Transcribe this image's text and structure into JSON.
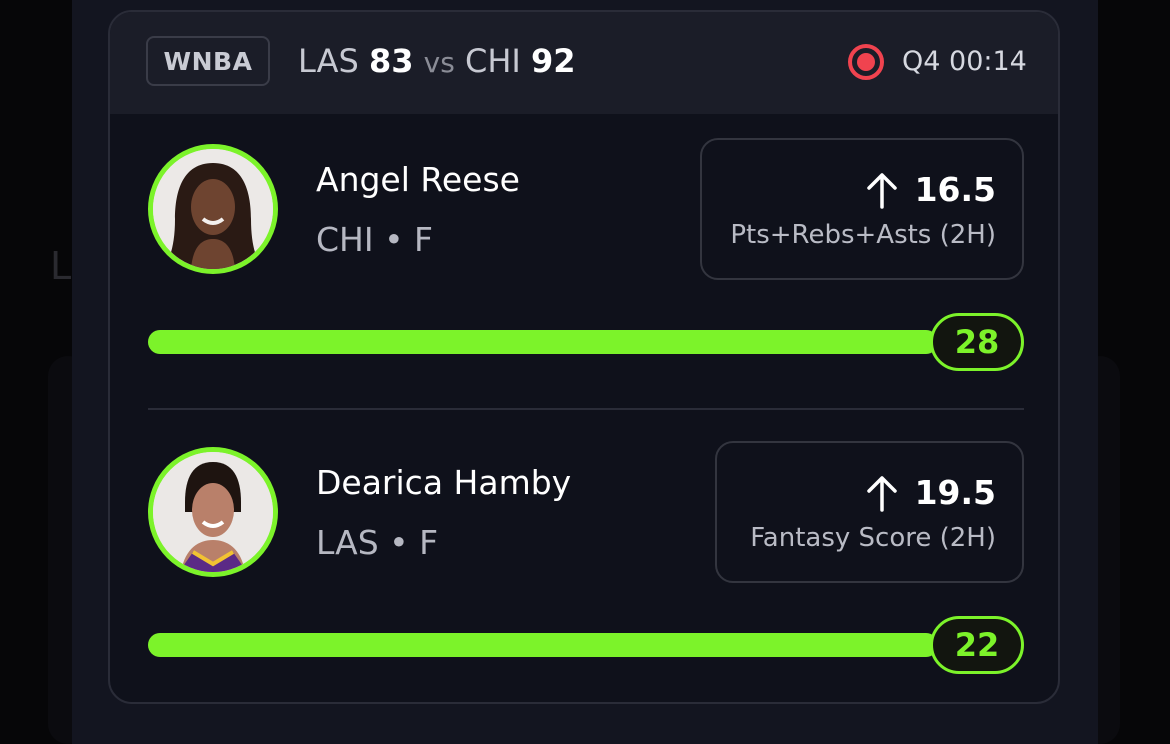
{
  "game": {
    "league": "WNBA",
    "away_team": "LAS",
    "away_score": "83",
    "vs": "vs",
    "home_team": "CHI",
    "home_score": "92",
    "clock": "Q4 00:14",
    "live_icon": "live-record-icon"
  },
  "background": {
    "ghost_letter": "L"
  },
  "players": [
    {
      "name": "Angel Reese",
      "meta": "CHI • F",
      "direction_icon": "arrow-up-icon",
      "line": "16.5",
      "stat": "Pts+Rebs+Asts (2H)",
      "current": "28",
      "progress": 1.0
    },
    {
      "name": "Dearica Hamby",
      "meta": "LAS • F",
      "direction_icon": "arrow-up-icon",
      "line": "19.5",
      "stat": "Fantasy Score (2H)",
      "current": "22",
      "progress": 1.0
    }
  ],
  "colors": {
    "accent": "#7cf32a",
    "live": "#f0434f",
    "card": "#0f111b",
    "header": "#1b1d28"
  }
}
